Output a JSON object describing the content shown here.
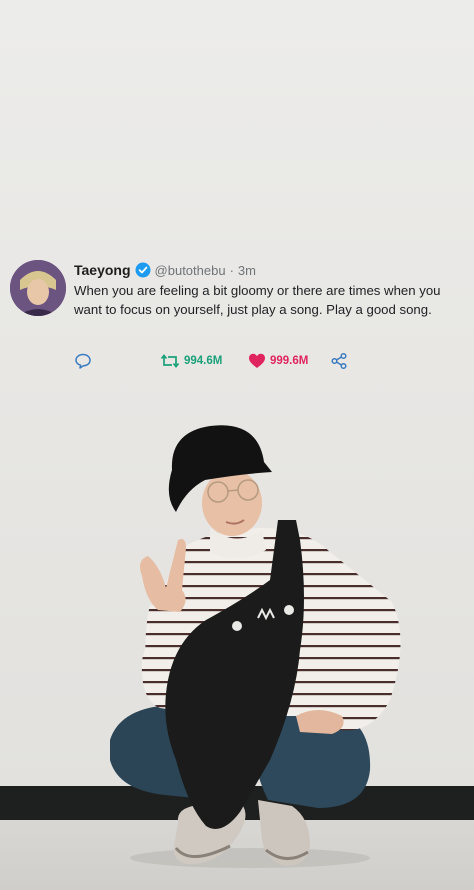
{
  "tweet": {
    "display_name": "Taeyong",
    "handle": "@butothebu",
    "separator": "·",
    "time": "3m",
    "text": "When you are feeling a bit gloomy or there are times when you want to focus on yourself, just play a song. Play a good song.",
    "retweet_count": "994.6M",
    "like_count": "999.6M",
    "icons": {
      "reply": "reply-icon",
      "retweet": "retweet-icon",
      "like": "heart-icon",
      "share": "share-icon",
      "verified": "verified-badge-icon"
    }
  },
  "colors": {
    "retweet": "#1aa179",
    "like": "#e0245e",
    "verified": "#1d9bf0",
    "wall": "#e9e8e5",
    "baseboard": "#1e201f"
  }
}
